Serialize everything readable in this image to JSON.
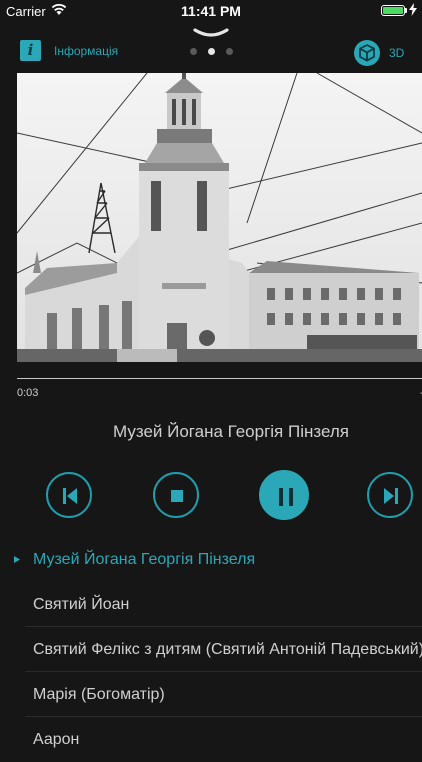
{
  "status_bar": {
    "carrier": "Carrier",
    "time": "11:41 PM",
    "battery_level": 1.0,
    "battery_color": "#4cd964"
  },
  "header": {
    "info_label": "Інформація",
    "info_icon_glyph": "i",
    "label_3d": "3D",
    "pages_total": 3,
    "page_current": 2
  },
  "player": {
    "elapsed": "0:03",
    "remaining": "-",
    "progress": 0.0,
    "title": "Музей Йогана Георгія Пінзеля"
  },
  "playlist": [
    {
      "label": "Музей Йогана Георгія Пінзеля",
      "playing": true
    },
    {
      "label": "Святий Йоан",
      "playing": false
    },
    {
      "label": "Святий Фелікс з дитям (Святий Антоній Падевський)",
      "playing": false
    },
    {
      "label": "Марія (Богоматір)",
      "playing": false
    },
    {
      "label": "Аарон",
      "playing": false
    }
  ],
  "colors": {
    "accent": "#2aa8b8",
    "background": "#161616",
    "text": "#cfcfcf"
  }
}
